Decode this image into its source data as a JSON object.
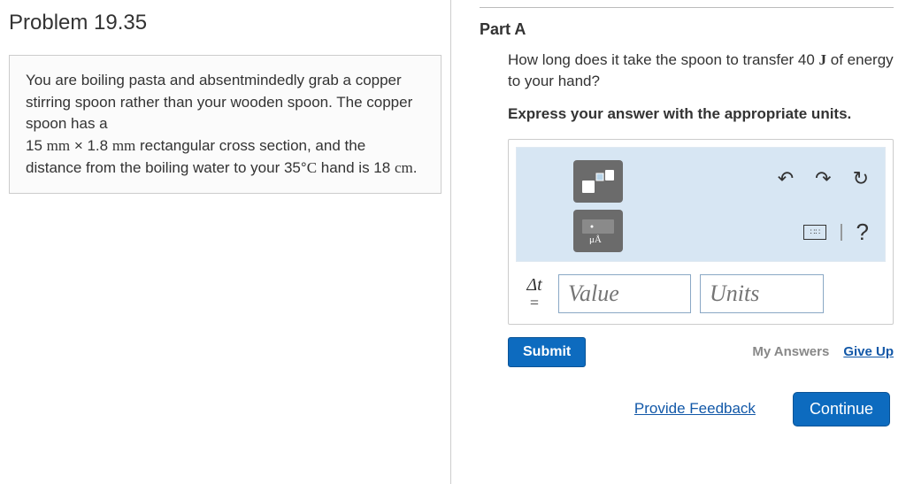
{
  "problem": {
    "title": "Problem 19.35",
    "text_html": "You are boiling pasta and absentmindedly grab a copper stirring spoon rather than your wooden spoon. The copper spoon has a<br>15 <span class='serif'>mm</span> × 1.8 <span class='serif'>mm</span> rectangular cross section, and the distance from the boiling water to your 35°<span class='serif'>C</span> hand is 18 <span class='serif'>cm</span>."
  },
  "part": {
    "label": "Part A",
    "question_html": "How long does it take the spoon to transfer 40 <span class='serif' style='font-weight:bold'>J</span> of energy to your hand?",
    "instruction": "Express your answer with the appropriate units."
  },
  "answer": {
    "variable": "Δt",
    "equals": "=",
    "value_placeholder": "Value",
    "units_placeholder": "Units"
  },
  "buttons": {
    "submit": "Submit",
    "my_answers": "My Answers",
    "give_up": "Give Up",
    "provide_feedback": "Provide Feedback",
    "continue": "Continue"
  },
  "icons": {
    "undo": "↶",
    "redo": "↷",
    "reset": "↻",
    "help": "?",
    "separator": "|"
  }
}
